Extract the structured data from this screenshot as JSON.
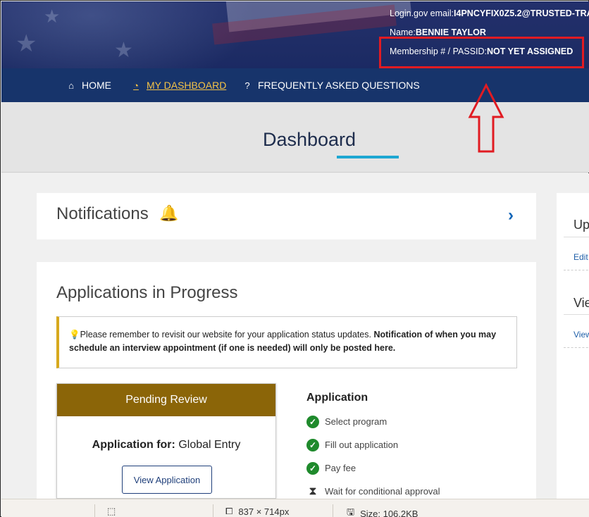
{
  "header": {
    "email_label": "Login.gov email:",
    "email_value": "I4PNCYFIX0Z5.2@TRUSTED-TRA",
    "name_label": "Name:",
    "name_value": "BENNIE TAYLOR",
    "membership_label": "Membership # / PASSID:",
    "membership_value": "NOT YET ASSIGNED"
  },
  "nav": {
    "items": [
      {
        "label": "HOME",
        "icon": "home-icon"
      },
      {
        "label": "MY DASHBOARD",
        "icon": "dashboard-icon"
      },
      {
        "label": "FREQUENTLY ASKED QUESTIONS",
        "icon": "question-icon"
      }
    ]
  },
  "page": {
    "title": "Dashboard"
  },
  "notifications": {
    "title": "Notifications"
  },
  "side": {
    "title1": "Up",
    "link1": "Edit",
    "title2": "Vie",
    "link2": "View"
  },
  "applications": {
    "title": "Applications in Progress",
    "alert_text": "Please remember to revisit our website for your application status updates. ",
    "alert_bold": "Notification of when you may schedule an interview appointment (if one is needed) will only be posted here.",
    "status": "Pending Review",
    "app_for_label": "Application for:",
    "app_for_value": "Global Entry",
    "view_button": "View Application",
    "steps_title": "Application",
    "steps": [
      {
        "label": "Select program",
        "state": "complete"
      },
      {
        "label": "Fill out application",
        "state": "complete"
      },
      {
        "label": "Pay fee",
        "state": "complete"
      },
      {
        "label": "Wait for conditional approval",
        "state": "pending"
      }
    ]
  },
  "statusbar": {
    "dimensions": "837 × 714px",
    "size": "Size: 106.2KB"
  },
  "colors": {
    "accent": "#17346b",
    "highlight": "#e11b22",
    "pending": "#8b6508",
    "check": "#1f8a2c"
  }
}
